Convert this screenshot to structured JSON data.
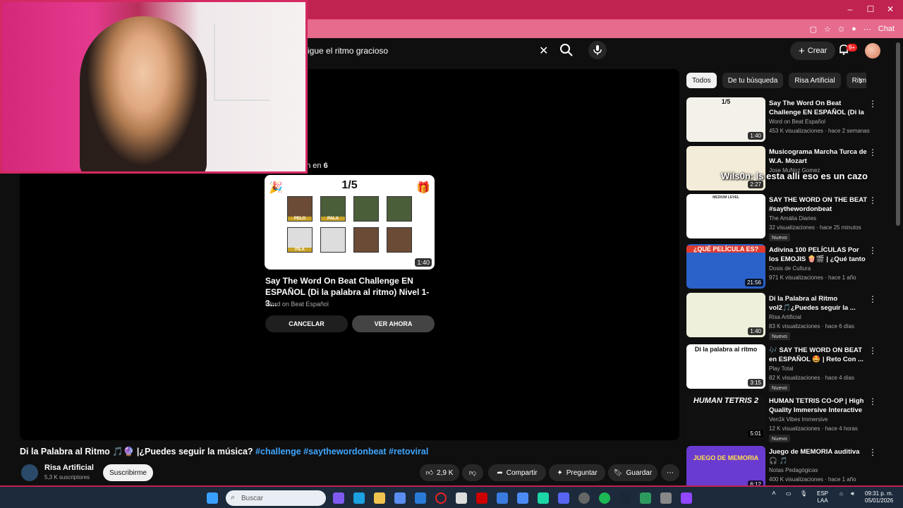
{
  "browser": {
    "minimize": "–",
    "maximize": "☐",
    "close": "✕",
    "chat_label": "Chat"
  },
  "youtube": {
    "search_value": "sigue el ritmo gracioso",
    "create_label": "Crear",
    "notif_count": "9+"
  },
  "player": {
    "overlay_text": "on en",
    "overlay_count": "6",
    "card": {
      "counter": "1/5",
      "tiles": [
        "PELO",
        "PALA",
        "",
        "",
        "PILA",
        "",
        "",
        ""
      ],
      "duration": "1:40"
    },
    "upnext_title": "Say The Word On Beat Challenge EN ESPAÑOL (Di la palabra al ritmo) Nivel 1-3...",
    "upnext_channel": "Word on Beat Español",
    "cancel_label": "CANCELAR",
    "watch_label": "VER AHORA"
  },
  "video": {
    "title_plain": "Di la Palabra al Ritmo 🎵🔮 |¿Puedes seguir la música?",
    "tags": [
      "#challenge",
      "#saythewordonbeat",
      "#retoviral"
    ],
    "channel": "Risa Artificial",
    "subscribers": "5,3 K suscriptores",
    "subscribe_label": "Suscribirme",
    "likes": "2,9 K",
    "share_label": "Compartir",
    "ask_label": "Preguntar",
    "save_label": "Guardar"
  },
  "chips": [
    "Todos",
    "De tu búsqueda",
    "Risa Artificial",
    "Ritmo"
  ],
  "stream_overlay": "Wils0n: ls esta alli eso es un cazo",
  "recommendations": [
    {
      "title": "Say The Word On Beat Challenge EN ESPAÑOL (Di la ...",
      "channel": "Word on Beat Español",
      "meta": "453 K visualizaciones · hace 2 semanas",
      "duration": "1:40",
      "new": "",
      "color": "#f4f1ea"
    },
    {
      "title": "Musicograma Marcha Turca de W.A. Mozart",
      "channel": "Jose MuNoz Gomez",
      "meta": "",
      "duration": "2:27",
      "new": "",
      "color": "#f3ecd8"
    },
    {
      "title": "SAY THE WORD ON THE BEAT #saythewordonbeat",
      "channel": "The Amália Diaries",
      "meta": "32 visualizaciones · hace 25 minutos",
      "duration": "",
      "new": "Nuevo",
      "color": "#ffffff"
    },
    {
      "title": "Adivina 100 PELÍCULAS Por los EMOJIS 🍿🎬 | ¿Qué tanto ...",
      "channel": "Dosis de Cultura",
      "meta": "971 K visualizaciones · hace 1 año",
      "duration": "21:56",
      "new": "",
      "color": "#2a62c9"
    },
    {
      "title": "Di la Palabra al Ritmo vol2🎵¿Puedes seguir la ...",
      "channel": "Risa Artificial",
      "meta": "83 K visualizaciones · hace 6 días",
      "duration": "1:40",
      "new": "Nuevo",
      "color": "#eef0dc"
    },
    {
      "title": "🎶 SAY THE WORD ON BEAT en ESPAÑOL 🤩 | Reto Con ...",
      "channel": "Play Total",
      "meta": "82 K visualizaciones · hace 4 días",
      "duration": "3:15",
      "new": "Nuevo",
      "color": "#ffffff"
    },
    {
      "title": "HUMAN TETRIS CO-OP | High Quality Immersive Interactive ...",
      "channel": "Ven1k Vibes Immersive",
      "meta": "12 K visualizaciones · hace 4 horas",
      "duration": "5:01",
      "new": "Nuevo",
      "color": "#111111"
    },
    {
      "title": "Juego de MEMORIA auditiva 🎧 🎵",
      "channel": "Notas Pedagógicas",
      "meta": "400 K visualizaciones · hace 1 año",
      "duration": "6:12",
      "new": "",
      "color": "#6a3bd0"
    }
  ],
  "rec_thumb_texts": {
    "counter": "1/5",
    "pelicula": "¿QUÉ PELÍCULA ES?",
    "dilapalabra": "Di la palabra al ritmo",
    "tetris": "HUMAN TETRIS 2",
    "medium": "MEDIUM LEVEL",
    "memoria": "JUEGO DE MEMORIA"
  },
  "taskbar": {
    "search_placeholder": "Buscar",
    "lang": "ESP",
    "lang2": "LAA",
    "time": "09:31 p. m.",
    "date": "05/01/2026"
  }
}
